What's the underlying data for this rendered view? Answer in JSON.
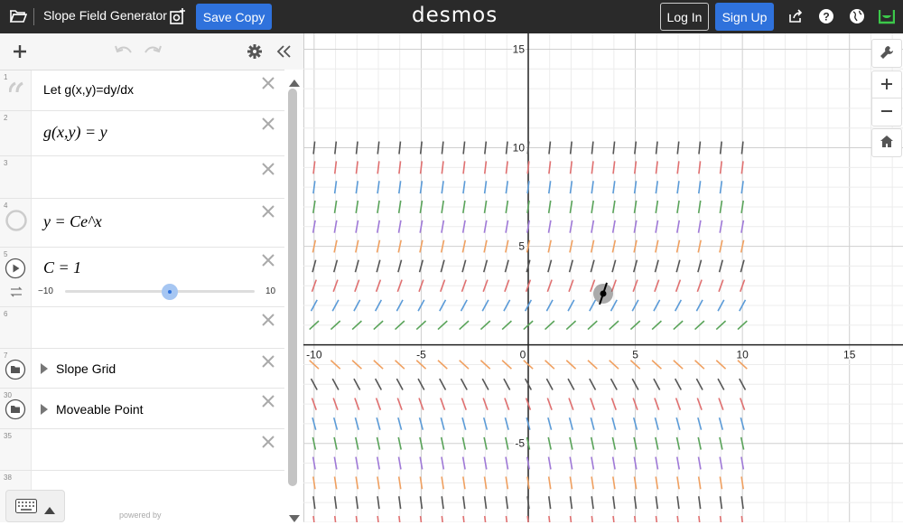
{
  "header": {
    "title": "Slope Field Generator",
    "save_label": "Save Copy",
    "logo": "desmos",
    "login_label": "Log In",
    "signup_label": "Sign Up"
  },
  "expressions": [
    {
      "num": "1",
      "text": "Let g(x,y)=dy/dx"
    },
    {
      "num": "2",
      "math": "g(x,y) = y"
    },
    {
      "num": "3"
    },
    {
      "num": "4",
      "math": "y = Ce^x"
    },
    {
      "num": "5",
      "math": "C = 1",
      "slider": {
        "min": "−10",
        "max": "10",
        "value": 1
      }
    },
    {
      "num": "6"
    },
    {
      "num": "7",
      "folder": "Slope Grid"
    },
    {
      "num": "30",
      "folder": "Moveable Point"
    },
    {
      "num": "35"
    },
    {
      "num": "38"
    }
  ],
  "footer": {
    "powered": "powered by"
  },
  "graph": {
    "x_ticks": [
      "-10",
      "-5",
      "0",
      "5",
      "10",
      "15"
    ],
    "y_ticks": [
      "15",
      "10",
      "5",
      "-5"
    ],
    "xlim": [
      -10.5,
      17.5
    ],
    "ylim": [
      -9.0,
      15.8
    ],
    "point": {
      "x": 3.5,
      "y": 2.6
    },
    "row_colors": [
      "#a07ad8",
      "#5aa45a",
      "#5b9bd8",
      "#e07070",
      "#555555",
      "#f0a060"
    ],
    "accent": "#2f72dc"
  }
}
